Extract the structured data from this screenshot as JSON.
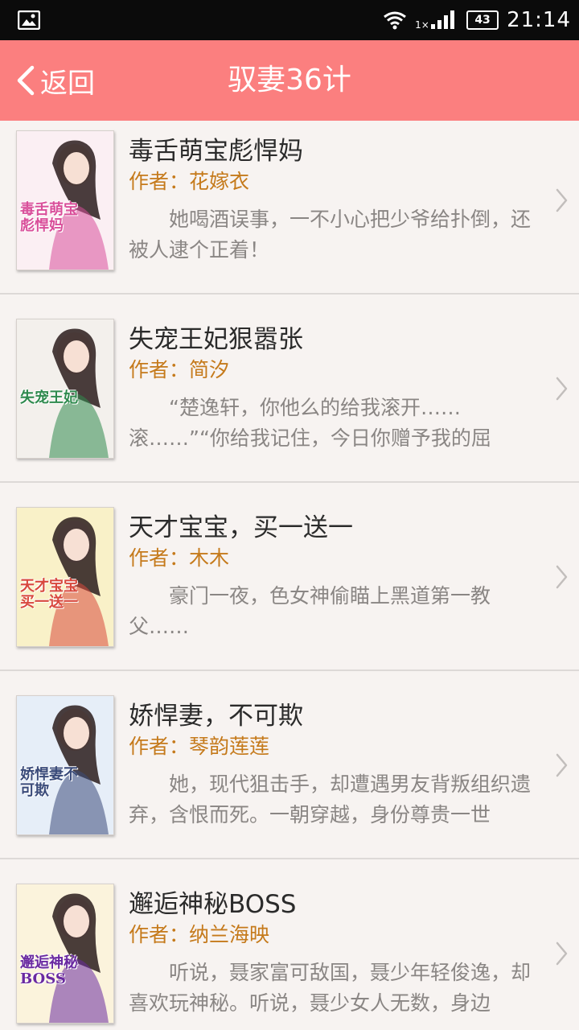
{
  "status_bar": {
    "time": "21:14",
    "battery": "43",
    "network": "1×",
    "icons": [
      "image-icon",
      "wifi-icon",
      "signal-icon",
      "battery-icon"
    ]
  },
  "header": {
    "back_label": "返回",
    "title": "驭妻36计",
    "background": "#fb7f7f"
  },
  "books": [
    {
      "title": "毒舌萌宝彪悍妈",
      "author_prefix": "作者：",
      "author": "花嫁衣",
      "desc": "她喝酒误事，一不小心把少爷给扑倒，还被人逮个正着！",
      "cover_text": "毒舌萌宝彪悍妈",
      "cover_colors": [
        "#fbeff3",
        "#d94f9a"
      ]
    },
    {
      "title": "失宠王妃狠嚣张",
      "author_prefix": "作者：",
      "author": "简汐",
      "desc": "“楚逸轩，你他么的给我滚开……滚……”“你给我记住，今日你赠予我的屈辱，",
      "cover_text": "失宠王妃",
      "cover_colors": [
        "#f3f0ec",
        "#2f8a4e"
      ]
    },
    {
      "title": "天才宝宝，买一送一",
      "author_prefix": "作者：",
      "author": "木木",
      "desc": "豪门一夜，色女神偷瞄上黑道第一教父……",
      "cover_text": "天才宝宝买一送一",
      "cover_colors": [
        "#f9f1c8",
        "#d8483d"
      ]
    },
    {
      "title": "娇悍妻，不可欺",
      "author_prefix": "作者：",
      "author": "琴韵莲莲",
      "desc": "她，现代狙击手，却遭遇男友背叛组织遗弃，含恨而死。一朝穿越，身份尊贵一世",
      "cover_text": "娇悍妻不可欺",
      "cover_colors": [
        "#e6eef8",
        "#3a4b7a"
      ]
    },
    {
      "title": "邂逅神秘BOSS",
      "author_prefix": "作者：",
      "author": "纳兰海映",
      "desc": "听说，聂家富可敌国，聂少年轻俊逸，却喜欢玩神秘。听说，聂少女人无数，身边",
      "cover_text": "邂逅神秘BOSS",
      "cover_colors": [
        "#fbf3dc",
        "#6a2aa0"
      ]
    }
  ]
}
